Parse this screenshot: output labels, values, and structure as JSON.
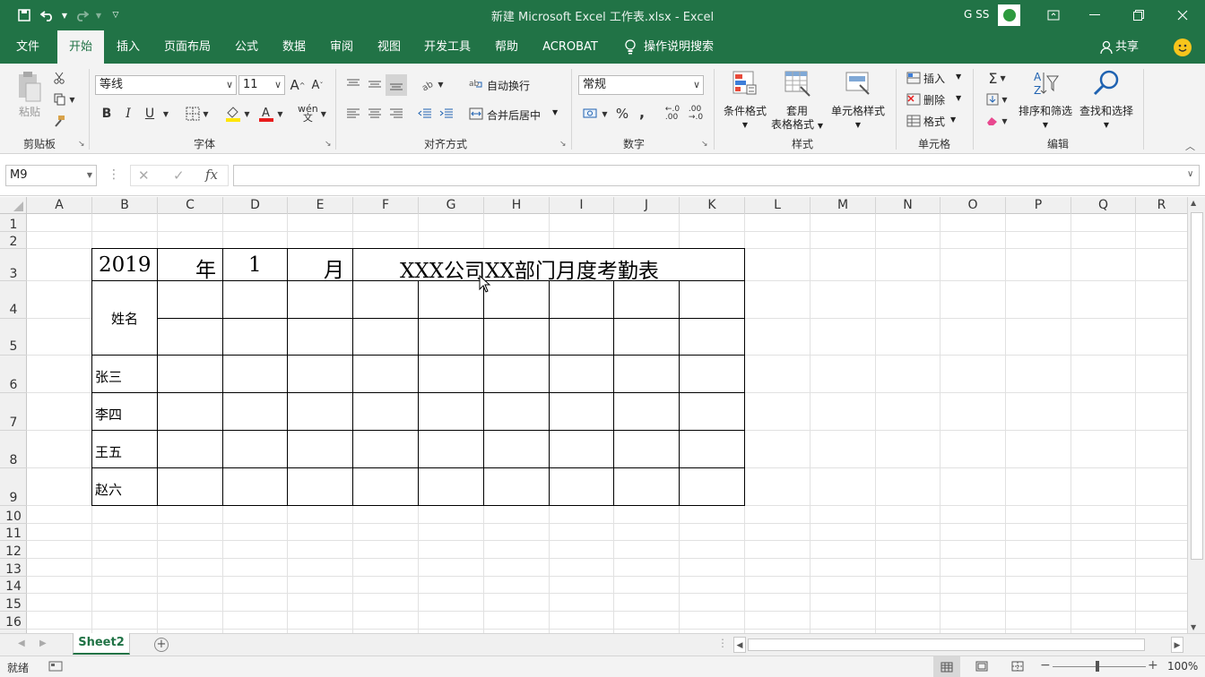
{
  "window": {
    "title": "新建 Microsoft Excel 工作表.xlsx  -  Excel",
    "user": "G SS"
  },
  "menu": {
    "tabs": [
      "文件",
      "开始",
      "插入",
      "页面布局",
      "公式",
      "数据",
      "审阅",
      "视图",
      "开发工具",
      "帮助",
      "ACROBAT"
    ],
    "search": "操作说明搜索",
    "share": "共享",
    "active_tab": "开始"
  },
  "ribbon": {
    "clipboard": {
      "paste": "粘贴",
      "label": "剪贴板"
    },
    "font": {
      "name": "等线",
      "size": "11",
      "label": "字体",
      "bold": "B",
      "italic": "I",
      "underline": "U"
    },
    "alignment": {
      "wrap": "自动换行",
      "merge": "合并后居中",
      "label": "对齐方式"
    },
    "number": {
      "format": "常规",
      "percent": "%",
      "comma": ",",
      "label": "数字"
    },
    "styles": {
      "conditional": "条件格式",
      "table_line1": "套用",
      "table_line2": "表格格式",
      "cell_styles": "单元格样式",
      "label": "样式"
    },
    "cells": {
      "insert": "插入",
      "delete": "删除",
      "format": "格式",
      "label": "单元格"
    },
    "editing": {
      "sort": "排序和筛选",
      "find": "查找和选择",
      "label": "编辑"
    }
  },
  "formula_bar": {
    "name_box": "M9",
    "fx": "fx",
    "value": ""
  },
  "columns": [
    "A",
    "B",
    "C",
    "D",
    "E",
    "F",
    "G",
    "H",
    "I",
    "J",
    "K",
    "L",
    "M",
    "N",
    "O",
    "P",
    "Q",
    "R"
  ],
  "rows": [
    "1",
    "2",
    "3",
    "4",
    "5",
    "6",
    "7",
    "8",
    "9",
    "10",
    "11",
    "12",
    "13",
    "14",
    "15",
    "16"
  ],
  "sheet_content": {
    "year": "2019",
    "year_unit": "年",
    "month": "1",
    "month_unit": "月",
    "title": "XXX公司XX部门月度考勤表",
    "name_header": "姓名",
    "names": [
      "张三",
      "李四",
      "王五",
      "赵六"
    ]
  },
  "sheet_tabs": {
    "active": "Sheet2"
  },
  "status": {
    "mode": "就绪",
    "zoom": "100%"
  },
  "colors": {
    "accent": "#217346",
    "ribbon_bg": "#f3f3f3"
  }
}
